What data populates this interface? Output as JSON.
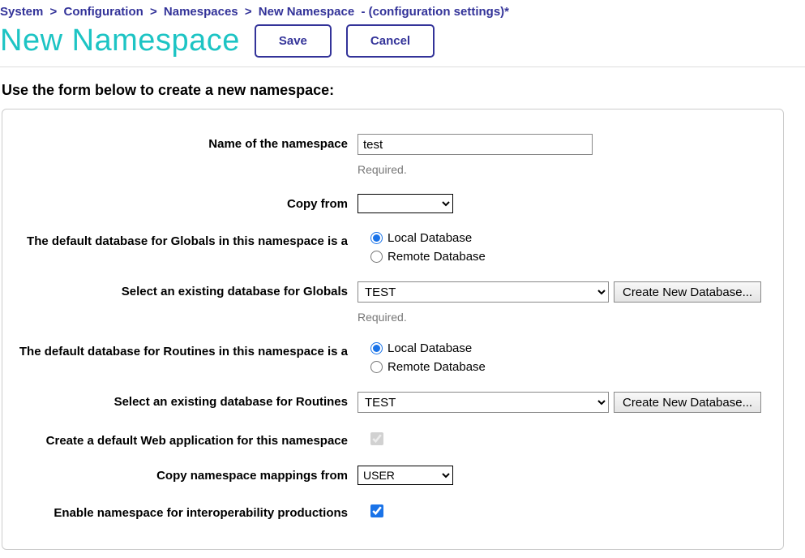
{
  "breadcrumb": {
    "items": [
      "System",
      "Configuration",
      "Namespaces",
      "New Namespace"
    ],
    "suffix": "- (configuration settings)*"
  },
  "header": {
    "title": "New Namespace",
    "save_label": "Save",
    "cancel_label": "Cancel"
  },
  "intro": "Use the form below to create a new namespace:",
  "form": {
    "name": {
      "label": "Name of the namespace",
      "value": "test",
      "hint": "Required."
    },
    "copy_from": {
      "label": "Copy from",
      "value": ""
    },
    "globals_db_type": {
      "label": "The default database for Globals in this namespace is a",
      "local_label": "Local Database",
      "remote_label": "Remote Database",
      "selected": "local"
    },
    "globals_db_select": {
      "label": "Select an existing database for Globals",
      "value": "TEST",
      "hint": "Required.",
      "create_btn": "Create New Database..."
    },
    "routines_db_type": {
      "label": "The default database for Routines in this namespace is a",
      "local_label": "Local Database",
      "remote_label": "Remote Database",
      "selected": "local"
    },
    "routines_db_select": {
      "label": "Select an existing database for Routines",
      "value": "TEST",
      "create_btn": "Create New Database..."
    },
    "create_webapp": {
      "label": "Create a default Web application for this namespace",
      "checked": true,
      "disabled": true
    },
    "copy_mappings": {
      "label": "Copy namespace mappings from",
      "value": "USER"
    },
    "enable_interop": {
      "label": "Enable namespace for interoperability productions",
      "checked": true
    }
  }
}
